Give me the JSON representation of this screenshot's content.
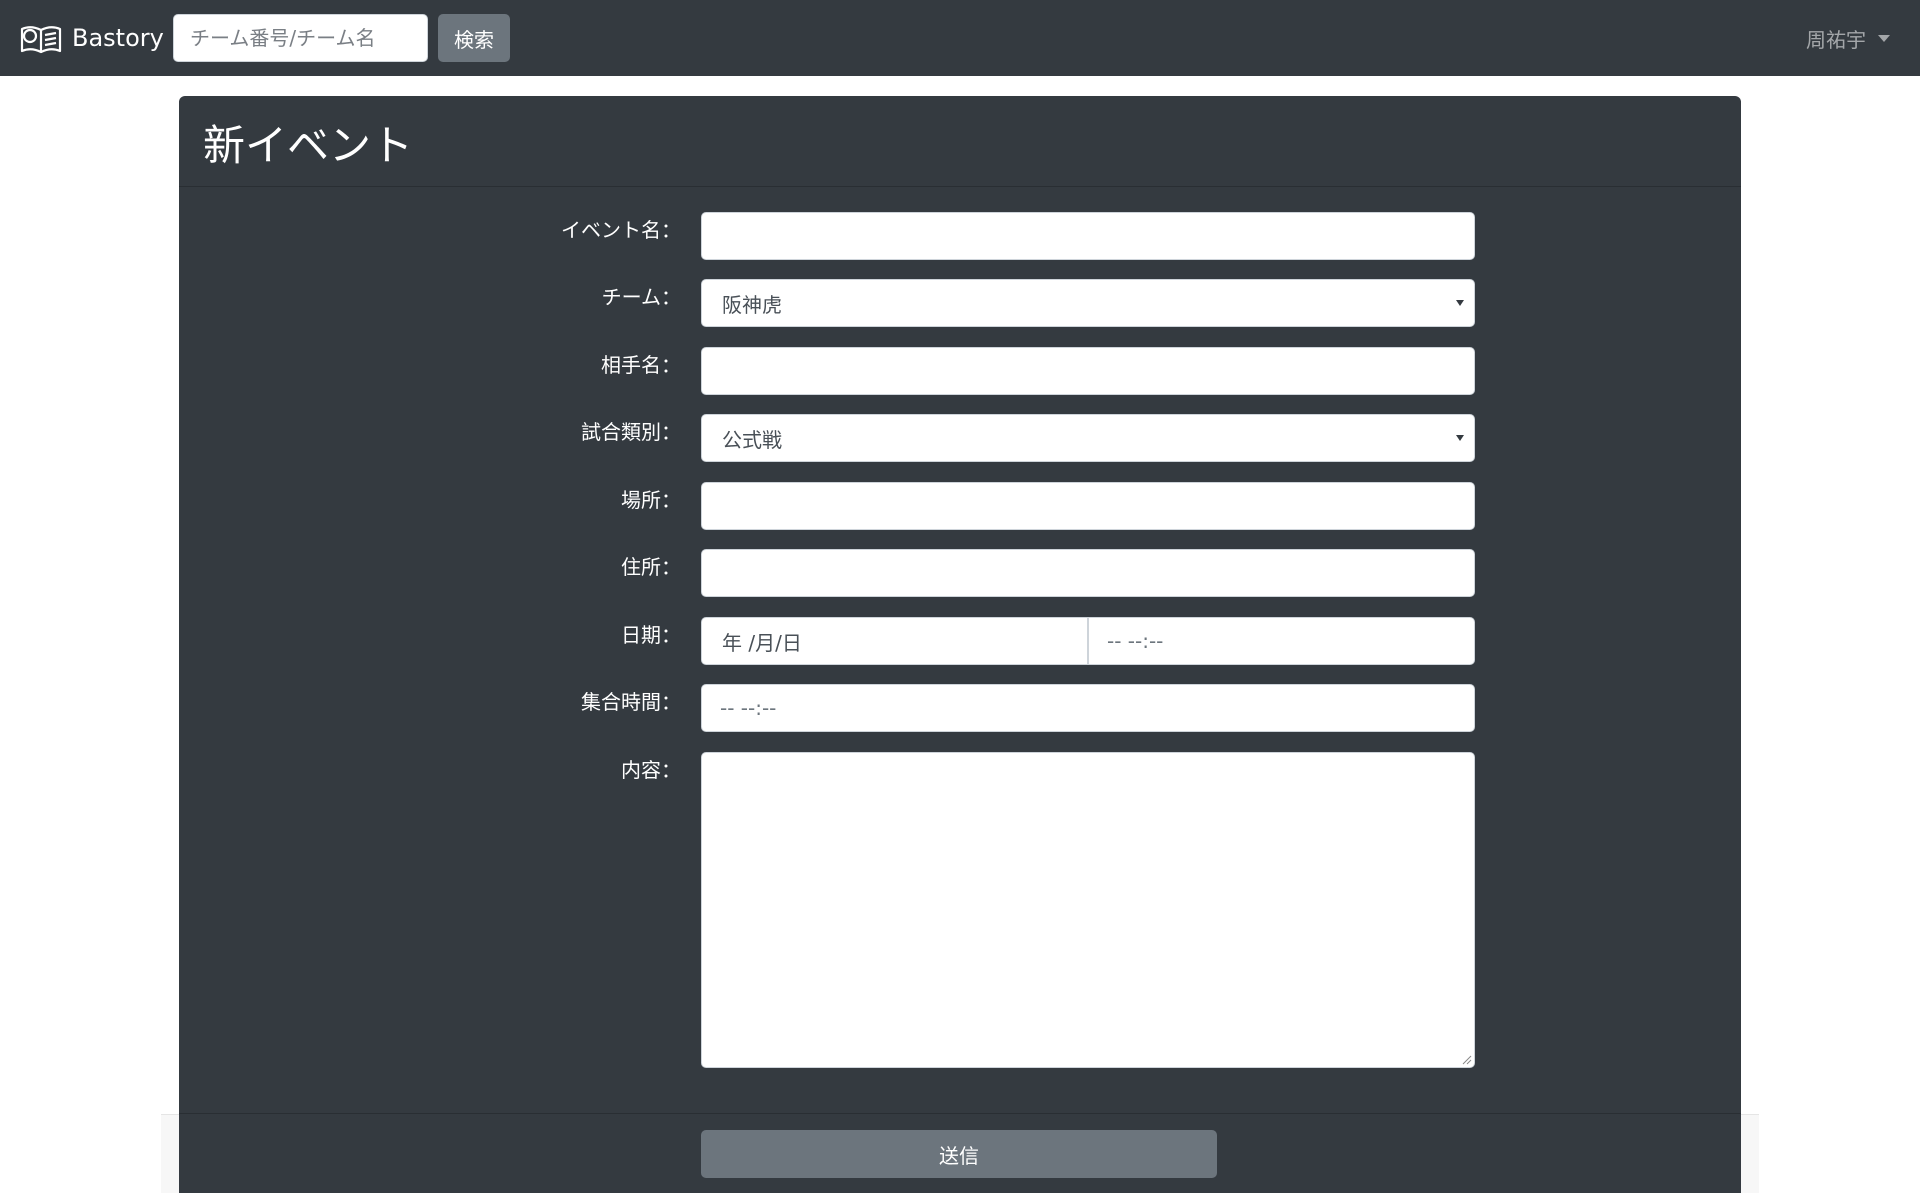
{
  "navbar": {
    "brand": "Bastory",
    "brand_icon": "open-book-icon",
    "search_placeholder": "チーム番号/チーム名",
    "search_button": "検索",
    "user_name": "周祐宇"
  },
  "form": {
    "title": "新イベント",
    "event_name_label": "イベント名：",
    "team_label": "チーム：",
    "team_value": "阪神虎",
    "opponent_label": "相手名：",
    "match_type_label": "試合類別：",
    "match_type_value": "公式戦",
    "place_label": "場所：",
    "address_label": "住所：",
    "date_label": "日期：",
    "date_placeholder": "年 /月/日",
    "time_placeholder": "-- --:--",
    "gather_time_label": "集合時間：",
    "gather_time_placeholder": "-- --:--",
    "content_label": "内容：",
    "submit_button": "送信"
  },
  "colors": {
    "navbar_bg": "#343a40",
    "card_bg": "#343a40",
    "button_bg": "#6c757d"
  }
}
